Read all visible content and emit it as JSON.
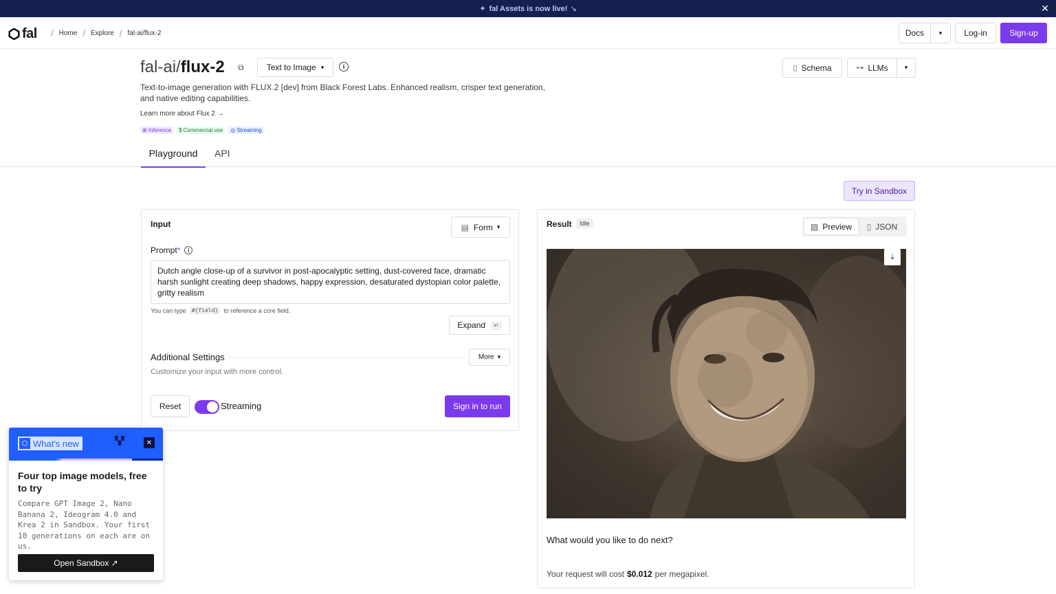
{
  "announcement": {
    "text": "fal Assets is now live!",
    "arrow": "↘"
  },
  "brand": {
    "name": "fal"
  },
  "breadcrumbs": [
    "Home",
    "Explore",
    "fal-ai/flux-2"
  ],
  "nav": {
    "docs": "Docs",
    "login": "Log-in",
    "signup": "Sign-up"
  },
  "model": {
    "owner": "fal-ai/",
    "name": "flux-2",
    "category": "Text to Image",
    "description": "Text-to-image generation with FLUX.2 [dev] from Black Forest Labs. Enhanced realism, crisper text generation, and native editing capabilities.",
    "learn_more": "Learn more about Flux 2 →",
    "tags": [
      {
        "icon": "⊞",
        "label": "Inference",
        "color": "#7c3aed",
        "bg": "#f1ebfe"
      },
      {
        "icon": "$",
        "label": "Commercial use",
        "color": "#15803d",
        "bg": "#ecfbef"
      },
      {
        "icon": "◎",
        "label": "Streaming",
        "color": "#1d4ed8",
        "bg": "#ebf1fe"
      }
    ]
  },
  "header_actions": {
    "schema": "Schema",
    "llms": "LLMs"
  },
  "tabs": [
    {
      "label": "Playground",
      "active": true
    },
    {
      "label": "API",
      "active": false
    }
  ],
  "sandbox_button": "Try in Sandbox",
  "input_panel": {
    "title": "Input",
    "mode": "Form",
    "prompt_label": "Prompt",
    "prompt_required": "*",
    "prompt_value": "Dutch angle close-up of a survivor in post-apocalyptic setting, dust-covered face, dramatic harsh sunlight creating deep shadows, happy expression, desaturated dystopian color palette, gritty realism",
    "hint_pre": "You can type",
    "hint_code": "#{field}",
    "hint_post": "to reference a core field.",
    "expand": "Expand",
    "additional_title": "Additional Settings",
    "more": "More",
    "additional_sub": "Customize your input with more control.",
    "reset": "Reset",
    "streaming": "Streaming",
    "streaming_on": true,
    "run": "Sign in to run"
  },
  "result_panel": {
    "title": "Result",
    "status": "Idle",
    "preview": "Preview",
    "json": "JSON",
    "next": "What would you like to do next?",
    "cost_pre": "Your request will cost",
    "cost_value": "$0.012",
    "cost_post": "per megapixel."
  },
  "whats_new": {
    "badge": "What's new",
    "title": "Four top image models, free to try",
    "body": "Compare GPT Image 2, Nano Banana 2, Ideogram 4.0 and Krea 2 in Sandbox. Your first 10 generations on each are on us.",
    "cta": "Open Sandbox ↗"
  },
  "colors": {
    "accent": "#7c3aed",
    "announce_bg": "#14214f",
    "popup_blue": "#1f5eff"
  }
}
